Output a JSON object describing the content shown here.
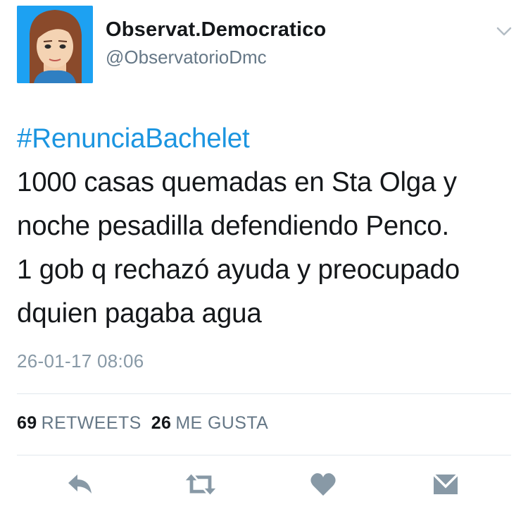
{
  "author": {
    "display_name": "Observat.Democratico",
    "handle": "@ObservatorioDmc",
    "avatar_icon": "cartoon-woman-avatar"
  },
  "tweet": {
    "hashtag": "#RenunciaBachelet",
    "lines": [
      "1000 casas quemadas en Sta Olga y",
      "noche pesadilla defendiendo Penco.",
      "1 gob q rechazó ayuda y preocupado",
      "dquien pagaba agua"
    ],
    "timestamp": "26-01-17 08:06"
  },
  "stats": {
    "retweets_count": "69",
    "retweets_label": "RETWEETS",
    "likes_count": "26",
    "likes_label": "ME GUSTA"
  },
  "actions": {
    "reply_icon": "reply-icon",
    "retweet_icon": "retweet-icon",
    "like_icon": "heart-icon",
    "dm_icon": "envelope-icon"
  },
  "colors": {
    "hashtag": "#1b95e0",
    "secondary_text": "#657786",
    "icon": "#8899a6",
    "avatar_bg": "#1da1f2"
  }
}
